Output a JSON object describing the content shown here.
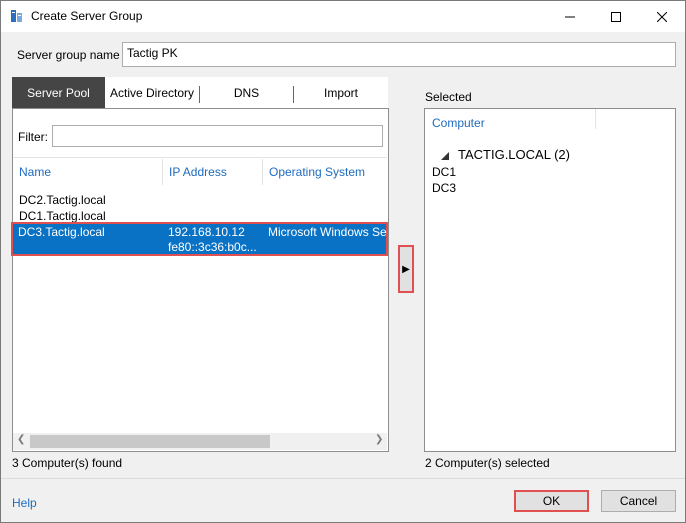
{
  "window": {
    "title": "Create Server Group",
    "minimize_glyph": "—",
    "maximize_glyph": "☐",
    "close_glyph": "✕"
  },
  "group_name": {
    "label": "Server group name",
    "value": "Tactig PK"
  },
  "tabs": [
    {
      "label": "Server Pool",
      "active": true
    },
    {
      "label": "Active Directory",
      "active": false
    },
    {
      "label": "DNS",
      "active": false
    },
    {
      "label": "Import",
      "active": false
    }
  ],
  "filter": {
    "label": "Filter:",
    "value": ""
  },
  "pool_table": {
    "columns": [
      "Name",
      "IP Address",
      "Operating System"
    ],
    "rows": [
      {
        "name": "DC2.Tactig.local",
        "ip": "",
        "ip2": "",
        "os": ""
      },
      {
        "name": "DC1.Tactig.local",
        "ip": "",
        "ip2": "",
        "os": ""
      },
      {
        "name": "DC3.Tactig.local",
        "ip": "192.168.10.12",
        "ip2": "fe80::3c36:b0c...",
        "os": "Microsoft Windows Se",
        "selected": true
      }
    ],
    "status": "3 Computer(s) found"
  },
  "move_button": {
    "glyph": "▶"
  },
  "selected": {
    "label": "Selected",
    "column": "Computer",
    "group": "TACTIG.LOCAL (2)",
    "items": [
      "DC1",
      "DC3"
    ],
    "status": "2 Computer(s) selected"
  },
  "footer": {
    "help": "Help",
    "ok": "OK",
    "cancel": "Cancel"
  },
  "colors": {
    "accent": "#0a72c5",
    "highlight_border": "#e05050",
    "link": "#1e6bbf"
  },
  "icons": {
    "app": "server-group-icon",
    "expand": "expand-triangle-icon"
  }
}
